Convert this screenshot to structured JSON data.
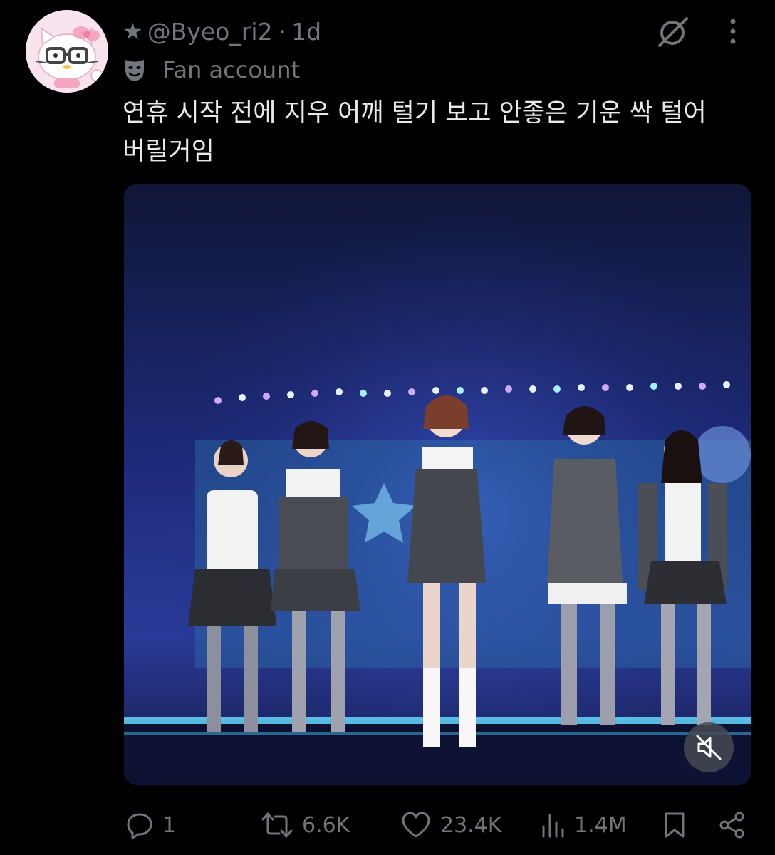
{
  "author": {
    "star": "★",
    "handle": "@Byeo_ri2",
    "separator": "·",
    "time": "1d",
    "badge_icon": "mask-icon",
    "badge_label": "Fan account"
  },
  "tweet": {
    "text": "연휴 시작 전에 지우 어깨 털기 보고 안좋은 기운 싹 털어\n버릴거임"
  },
  "media": {
    "type": "video",
    "mute_icon": "speaker-muted-icon"
  },
  "actions": {
    "replies": "1",
    "reposts": "6.6K",
    "likes": "23.4K",
    "views": "1.4M"
  },
  "colors": {
    "background": "#000000",
    "text": "#e7e9ea",
    "muted": "#71767b"
  }
}
